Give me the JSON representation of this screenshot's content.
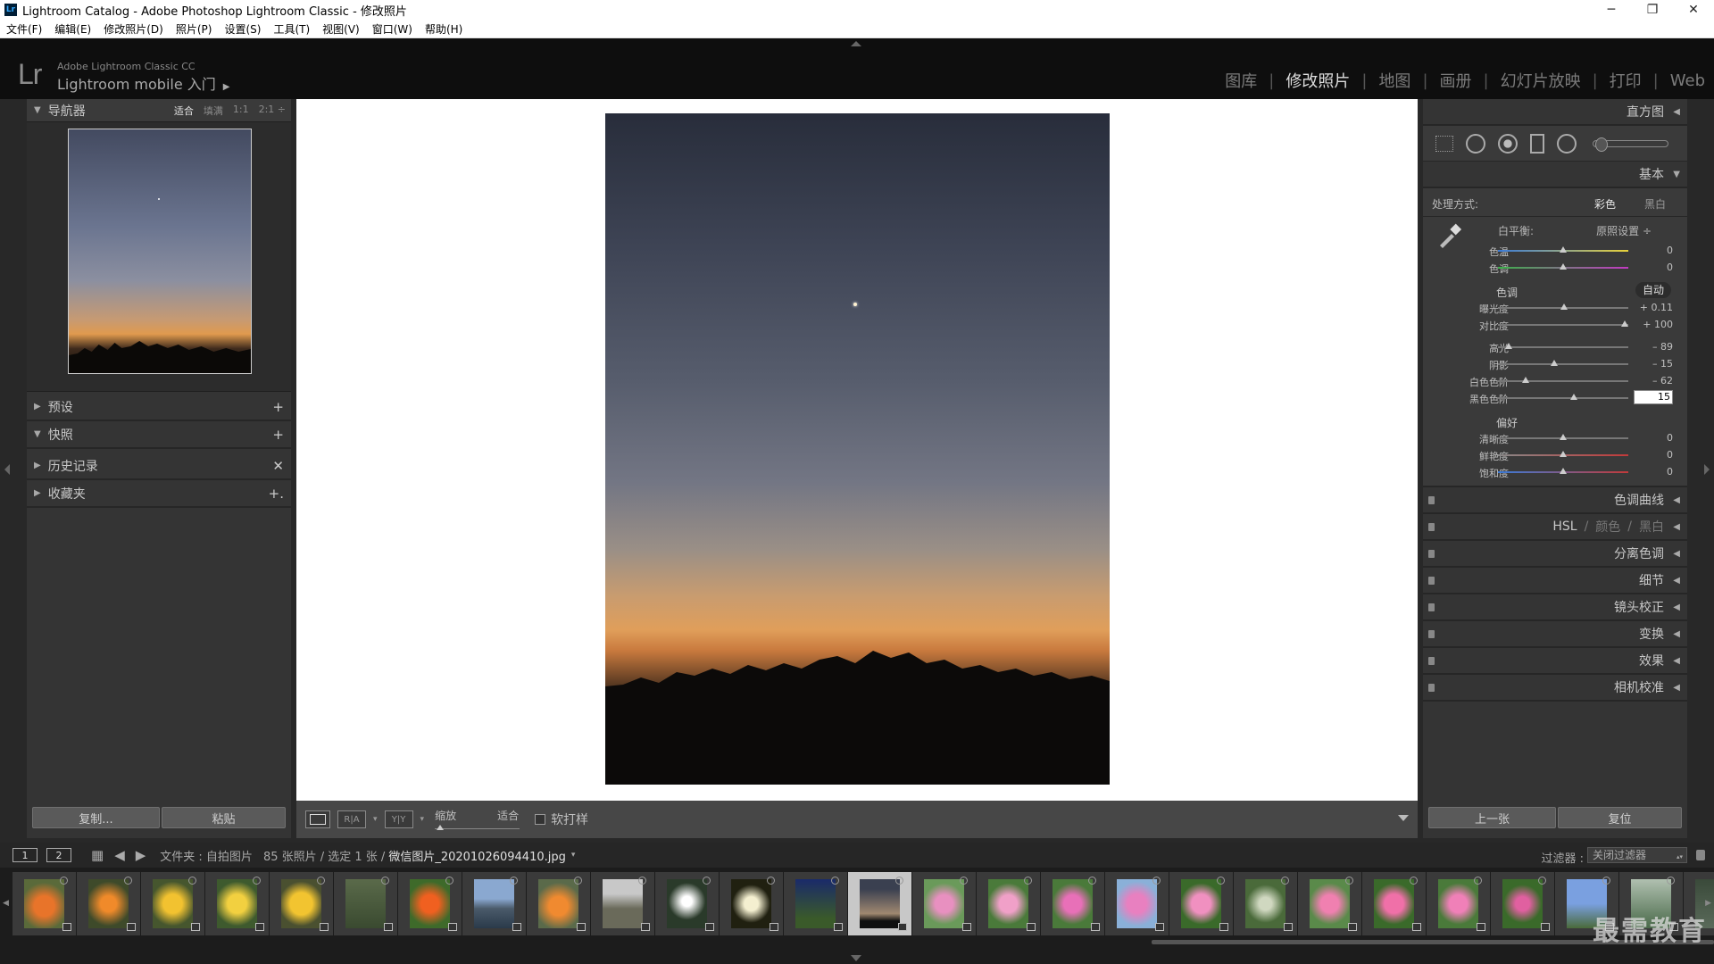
{
  "window": {
    "title": "Lightroom Catalog - Adobe Photoshop Lightroom Classic - 修改照片",
    "icon_text": "Lr",
    "controls": [
      "─",
      "❐",
      "✕"
    ]
  },
  "menu": [
    "文件(F)",
    "编辑(E)",
    "修改照片(D)",
    "照片(P)",
    "设置(S)",
    "工具(T)",
    "视图(V)",
    "窗口(W)",
    "帮助(H)"
  ],
  "identity": {
    "logo": "Lr",
    "line1": "Adobe Lightroom Classic CC",
    "line2": "Lightroom mobile 入门",
    "play_icon": "▶"
  },
  "modules": [
    {
      "label": "图库",
      "active": false
    },
    {
      "label": "修改照片",
      "active": true
    },
    {
      "label": "地图",
      "active": false
    },
    {
      "label": "画册",
      "active": false
    },
    {
      "label": "幻灯片放映",
      "active": false
    },
    {
      "label": "打印",
      "active": false
    },
    {
      "label": "Web",
      "active": false
    }
  ],
  "left_panel": {
    "navigator": {
      "title": "导航器",
      "zoom_options": [
        "适合",
        "填满",
        "1:1",
        "2:1 ÷"
      ],
      "active_zoom": "适合"
    },
    "sections": [
      {
        "label": "预设",
        "expanded": false,
        "action": "+"
      },
      {
        "label": "快照",
        "expanded": true,
        "action": "+"
      },
      {
        "label": "历史记录",
        "expanded": false,
        "action": "✕"
      },
      {
        "label": "收藏夹",
        "expanded": false,
        "action": "+."
      }
    ],
    "copy_label": "复制...",
    "paste_label": "粘贴"
  },
  "toolbar": {
    "ry_label": "R|A",
    "yy_label": "Y|Y",
    "zoom_label": "缩放",
    "fit_label": "适合",
    "softproof_label": "软打样"
  },
  "right_panel": {
    "histogram_label": "直方图",
    "basic_label": "基本",
    "treatment": {
      "label": "处理方式:",
      "color": "彩色",
      "bw": "黑白"
    },
    "white_balance": {
      "label": "白平衡:",
      "value": "原照设置 ÷"
    },
    "wb_sliders": [
      {
        "label": "色温",
        "value": "0",
        "position": 0.5,
        "colors": [
          "#3b7bd8",
          "#e8d23a"
        ]
      },
      {
        "label": "色调",
        "value": "0",
        "position": 0.5,
        "colors": [
          "#3cb04a",
          "#c23ac2"
        ]
      }
    ],
    "tone_title": "色调",
    "auto_label": "自动",
    "tone_sliders": [
      {
        "label": "曝光度",
        "value": "+ 0.11",
        "position": 0.51
      },
      {
        "label": "对比度",
        "value": "+ 100",
        "position": 0.97
      }
    ],
    "region_sliders": [
      {
        "label": "高光",
        "value": "– 89",
        "position": 0.08
      },
      {
        "label": "阴影",
        "value": "– 15",
        "position": 0.43
      },
      {
        "label": "白色色阶",
        "value": "– 62",
        "position": 0.21
      },
      {
        "label": "黑色色阶",
        "value": "15",
        "position": 0.58,
        "editing": true
      }
    ],
    "presence_title": "偏好",
    "presence_sliders": [
      {
        "label": "清晰度",
        "value": "0",
        "position": 0.5
      },
      {
        "label": "鲜艳度",
        "value": "0",
        "position": 0.5,
        "colors": [
          "#888888",
          "#c23a3a"
        ]
      },
      {
        "label": "饱和度",
        "value": "0",
        "position": 0.5,
        "colors": [
          "#3b7bd8",
          "#c23a3a"
        ]
      }
    ],
    "collapsed_panels": [
      "色调曲线",
      "分离色调",
      "细节",
      "镜头校正",
      "变换",
      "效果",
      "相机校准"
    ],
    "hsl": {
      "hsl": "HSL",
      "color": "颜色",
      "bw": "黑白",
      "sep": "/"
    },
    "prev_label": "上一张",
    "reset_label": "复位"
  },
  "filmstrip_bar": {
    "screen1": "1",
    "screen2": "2",
    "grid_icon": "▦",
    "back_icon": "◀",
    "fwd_icon": "▶",
    "path": "文件夹 : 自拍图片",
    "count": "85 张照片 / 选定 1 张 /",
    "filename": "微信图片_20201026094410.jpg",
    "filename_dd": "▾",
    "filter_label": "过滤器 :",
    "filter_value": "关闭过滤器"
  },
  "watermark": "最需教育",
  "colors": {
    "accent": "#e09e5a",
    "panel": "#343434",
    "background": "#282828"
  }
}
